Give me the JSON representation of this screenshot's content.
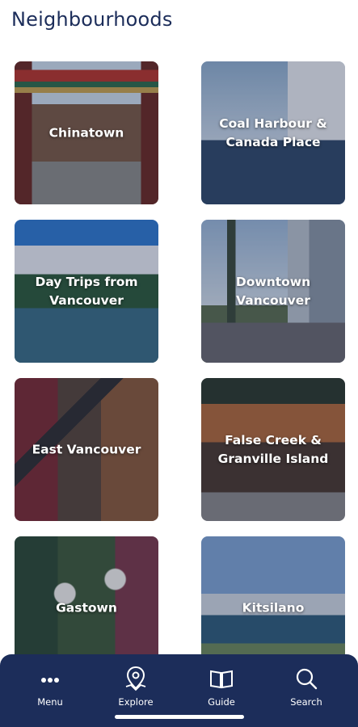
{
  "page": {
    "title": "Neighbourhoods"
  },
  "tiles": [
    {
      "label": "Chinatown"
    },
    {
      "label": "Coal Harbour & Canada Place"
    },
    {
      "label": "Day Trips from Vancouver"
    },
    {
      "label": "Downtown Vancouver"
    },
    {
      "label": "East Vancouver"
    },
    {
      "label": "False Creek & Granville Island"
    },
    {
      "label": "Gastown"
    },
    {
      "label": "Kitsilano"
    }
  ],
  "nav": {
    "items": [
      {
        "label": "Menu",
        "icon": "ellipsis-icon"
      },
      {
        "label": "Explore",
        "icon": "map-pin-icon"
      },
      {
        "label": "Guide",
        "icon": "open-book-icon"
      },
      {
        "label": "Search",
        "icon": "search-icon"
      }
    ]
  },
  "colors": {
    "brand": "#1c2d5a",
    "background": "#ffffff"
  }
}
